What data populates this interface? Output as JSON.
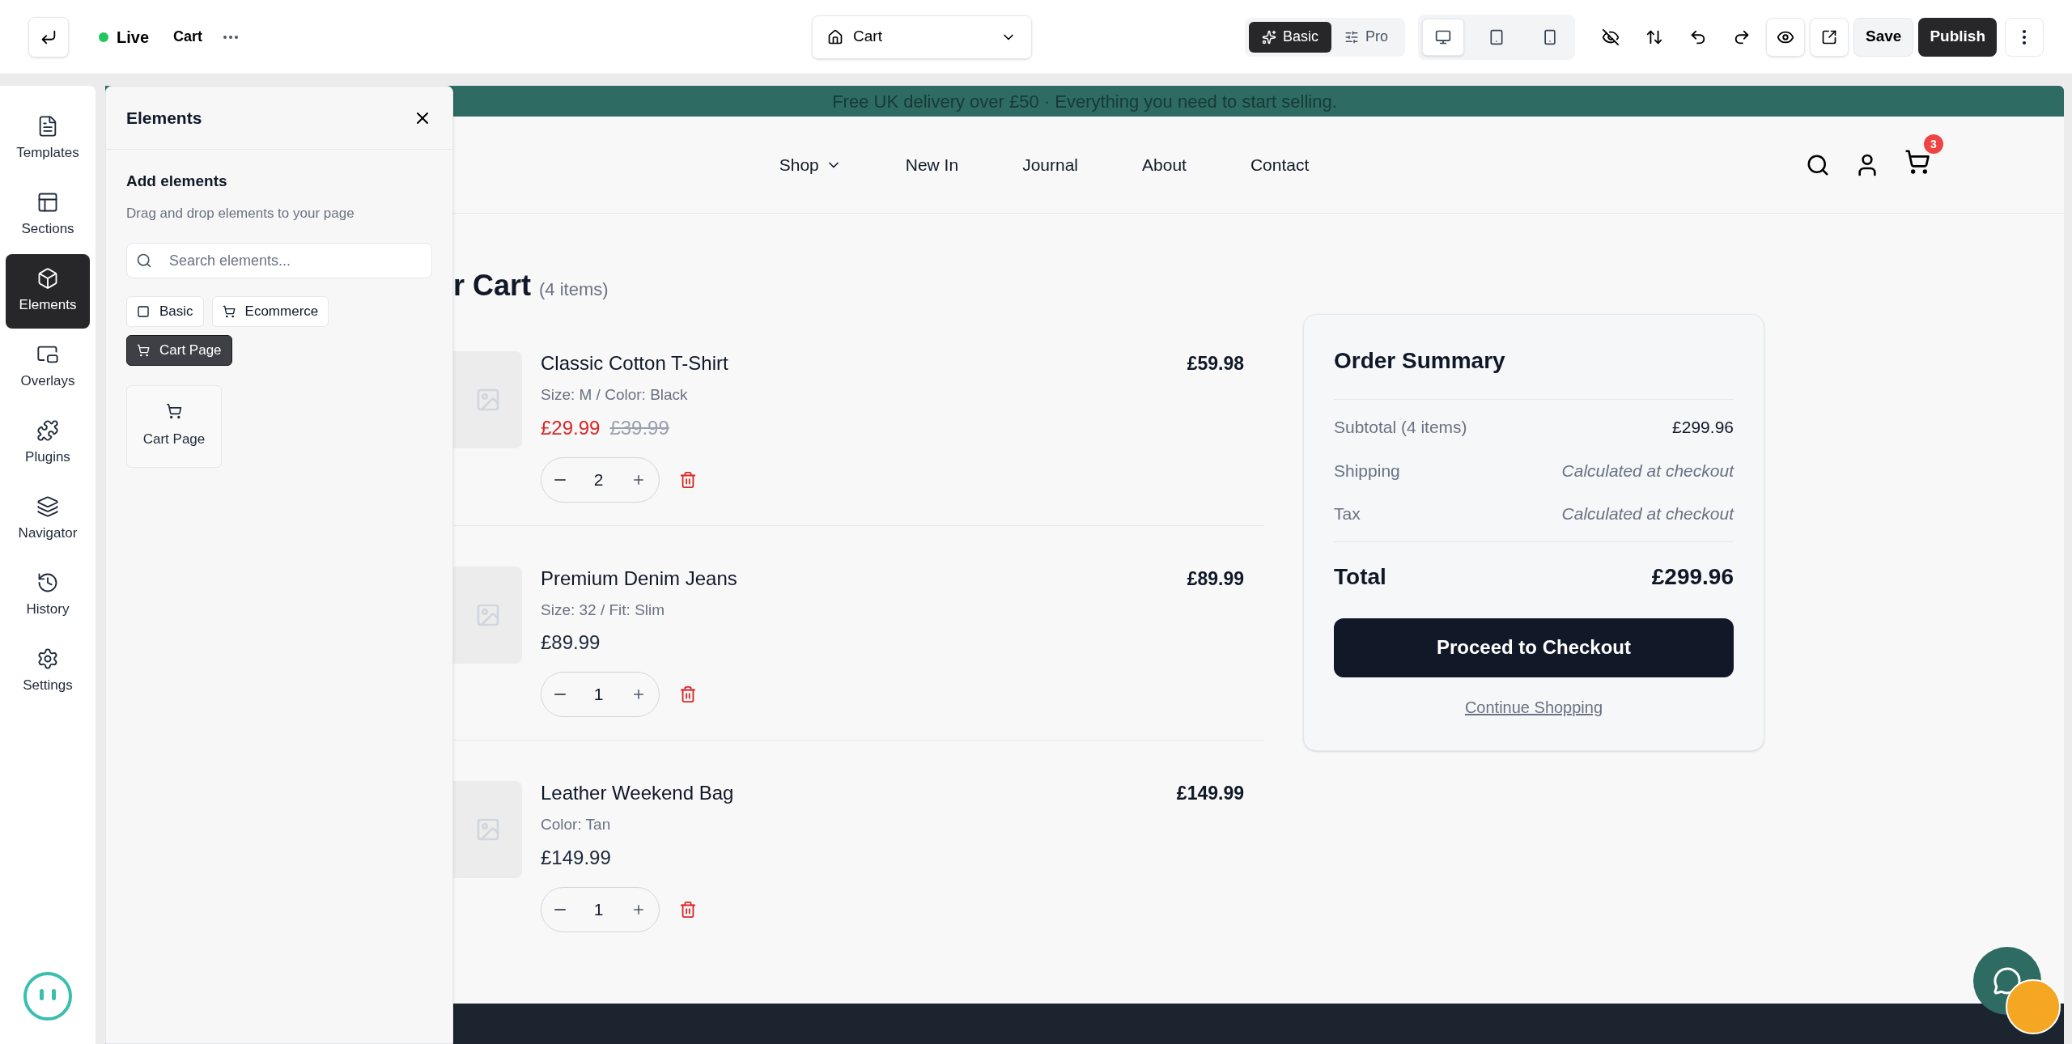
{
  "top_bar": {
    "status": "Live",
    "page_name": "Cart",
    "page_selector": "Cart",
    "modes": [
      {
        "label": "Basic",
        "kind": "basic",
        "selected": true
      },
      {
        "label": "Pro",
        "kind": "pro",
        "selected": false
      }
    ],
    "devices": [
      {
        "kind": "desktop",
        "selected": true
      },
      {
        "kind": "tablet",
        "selected": false
      },
      {
        "kind": "mobile",
        "selected": false
      }
    ],
    "save": "Save",
    "publish": "Publish"
  },
  "sidebar": {
    "items": [
      {
        "label": "Templates",
        "kind": "templates",
        "selected": false
      },
      {
        "label": "Sections",
        "kind": "sections",
        "selected": false
      },
      {
        "label": "Elements",
        "kind": "elements",
        "selected": true
      },
      {
        "label": "Overlays",
        "kind": "overlays",
        "selected": false
      },
      {
        "label": "Plugins",
        "kind": "plugins",
        "selected": false
      },
      {
        "label": "Navigator",
        "kind": "navigator",
        "selected": false
      },
      {
        "label": "History",
        "kind": "history",
        "selected": false
      },
      {
        "label": "Settings",
        "kind": "settings",
        "selected": false
      }
    ]
  },
  "elements_panel": {
    "title": "Elements",
    "heading": "Add elements",
    "subtitle": "Drag and drop elements to your page",
    "search": {
      "placeholder": "Search elements..."
    },
    "categories": [
      {
        "label": "Basic",
        "kind": "basic",
        "selected": false
      },
      {
        "label": "Ecommerce",
        "kind": "cart",
        "selected": false
      },
      {
        "label": "Cart Page",
        "kind": "cart",
        "selected": true
      }
    ],
    "cards": [
      {
        "label": "Cart Page"
      }
    ]
  },
  "site": {
    "banner": "Free UK delivery over £50 · Everything you need to start selling.",
    "nav": [
      {
        "label": "Shop",
        "dropdown": true
      },
      {
        "label": "New In",
        "dropdown": false
      },
      {
        "label": "Journal",
        "dropdown": false
      },
      {
        "label": "About",
        "dropdown": false
      },
      {
        "label": "Contact",
        "dropdown": false
      }
    ],
    "cart_badge": "3",
    "cart_title": "r Cart",
    "cart_count": "(4 items)",
    "items": [
      {
        "name": "Classic Cotton T-Shirt",
        "details": "Size: M / Color: Black",
        "price": "£29.99",
        "sale": true,
        "original_price": "£39.99",
        "quantity": "2",
        "line_total": "£59.98"
      },
      {
        "name": "Premium Denim Jeans",
        "details": "Size: 32 / Fit: Slim",
        "price": "£89.99",
        "sale": false,
        "quantity": "1",
        "line_total": "£89.99"
      },
      {
        "name": "Leather Weekend Bag",
        "details": "Color: Tan",
        "price": "£149.99",
        "sale": false,
        "quantity": "1",
        "line_total": "£149.99"
      }
    ],
    "summary": {
      "title": "Order Summary",
      "rows": [
        {
          "label": "Subtotal (4 items)",
          "value": "£299.96",
          "kind": "amount"
        },
        {
          "label": "Shipping",
          "value": "Calculated at checkout",
          "kind": "note"
        },
        {
          "label": "Tax",
          "value": "Calculated at checkout",
          "kind": "note"
        }
      ],
      "total_label": "Total",
      "total_value": "£299.96",
      "checkout": "Proceed to Checkout",
      "continue": "Continue Shopping"
    }
  }
}
